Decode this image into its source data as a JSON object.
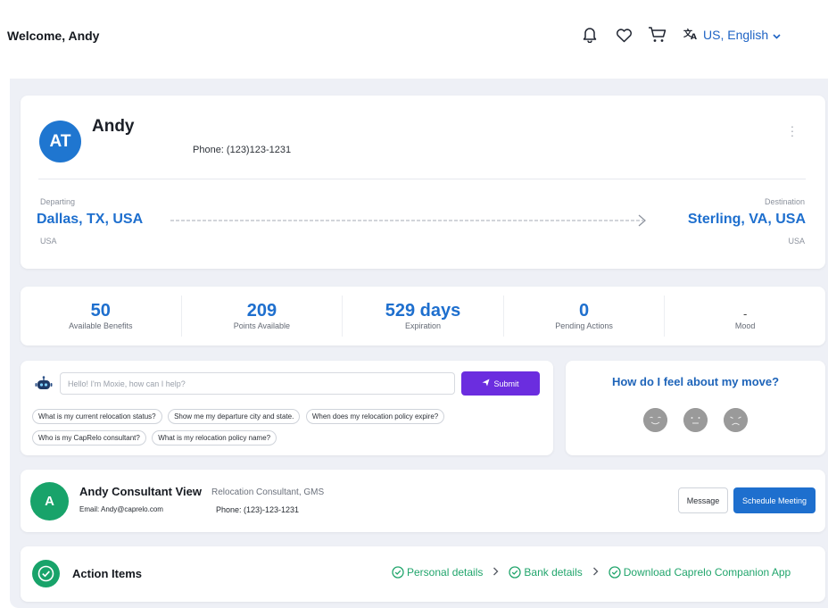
{
  "header": {
    "welcome": "Welcome, Andy",
    "language": "US, English"
  },
  "profile": {
    "initials": "AT",
    "name": "Andy",
    "phone": "Phone: (123)123-1231",
    "departing_label": "Departing",
    "departing_city": "Dallas, TX, USA",
    "departing_country": "USA",
    "destination_label": "Destination",
    "destination_city": "Sterling, VA, USA",
    "destination_country": "USA"
  },
  "stats": [
    {
      "value": "50",
      "label": "Available Benefits"
    },
    {
      "value": "209",
      "label": "Points Available"
    },
    {
      "value": "529 days",
      "label": "Expiration"
    },
    {
      "value": "0",
      "label": "Pending Actions"
    },
    {
      "value": "-",
      "label": "Mood"
    }
  ],
  "chat": {
    "placeholder": "Hello! I'm Moxie, how can I help?",
    "submit_label": "Submit",
    "suggestions": [
      "What is my current relocation status?",
      "Show me my departure city and state.",
      "When does my relocation policy expire?",
      "Who is my CapRelo consultant?",
      "What is my relocation policy name?"
    ]
  },
  "mood": {
    "title": "How do I feel about my move?",
    "faces": [
      "happy-face-icon",
      "neutral-face-icon",
      "sad-face-icon"
    ]
  },
  "consultant": {
    "initial": "A",
    "name": "Andy Consultant View",
    "role": "Relocation Consultant, GMS",
    "email": "Email: Andy@caprelo.com",
    "phone": "Phone: (123)-123-1231",
    "message_label": "Message",
    "schedule_label": "Schedule Meeting"
  },
  "action_items": {
    "title": "Action Items",
    "steps": [
      "Personal details",
      "Bank details",
      "Download Caprelo Companion App"
    ]
  },
  "colors": {
    "primary_blue": "#1e6fce",
    "submit_purple": "#6b2ddf",
    "success_green": "#18a36a"
  }
}
